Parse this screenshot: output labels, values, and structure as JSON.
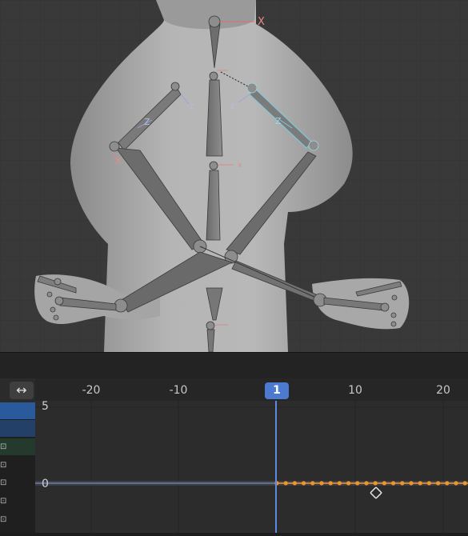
{
  "viewport": {
    "axis_labels": {
      "neck_x": "X",
      "upper_arm_left_z": "Z",
      "upper_arm_right_z": "Z",
      "forearm_left_z": "z",
      "forearm_right_z": "z",
      "hand_left_x": "X",
      "small_x": "x"
    }
  },
  "graph_editor": {
    "toggle_icon": "↔",
    "ruler": [
      "-20",
      "-10",
      "10",
      "20"
    ],
    "current_frame": "1",
    "y_labels": {
      "top": "5",
      "zero": "0"
    },
    "keyframe_color": "#f0932b",
    "playhead_color": "#4c7ad1"
  },
  "colors": {
    "selected_channel": "#2a5a9c",
    "channel_highlight": "#234068",
    "channel_green": "#233a2c"
  }
}
